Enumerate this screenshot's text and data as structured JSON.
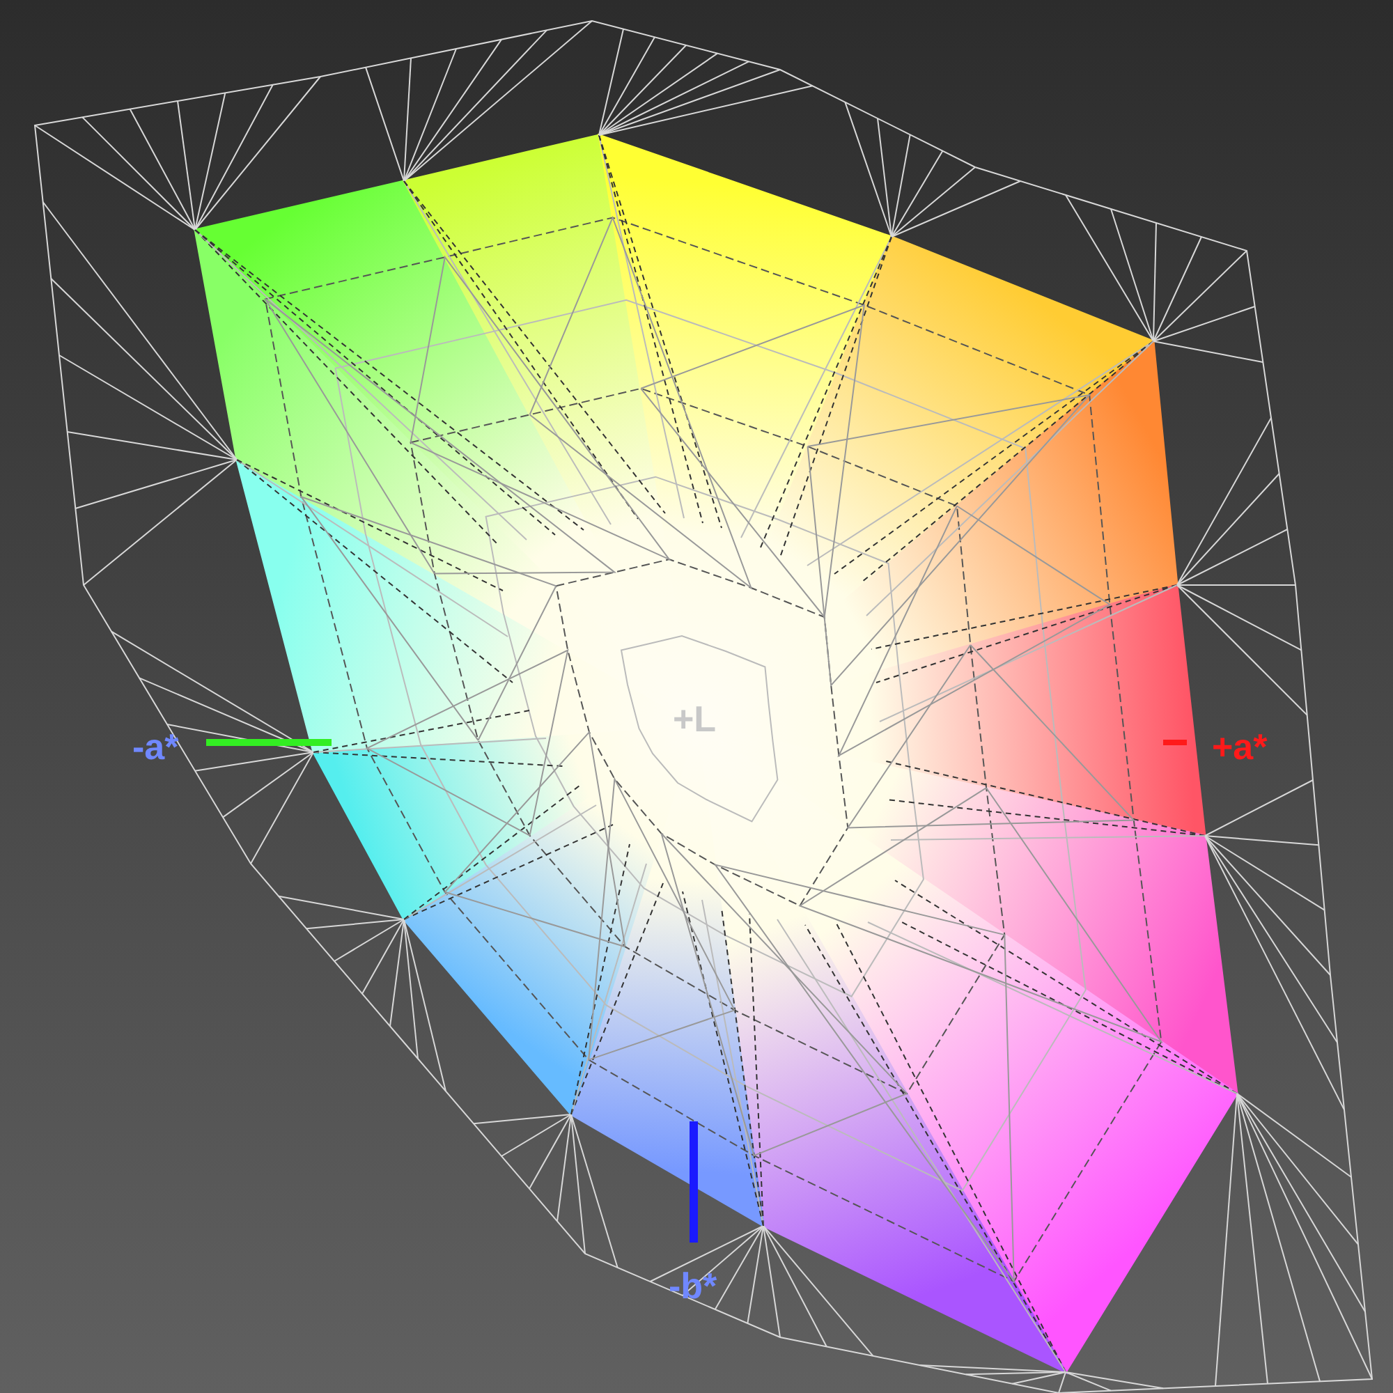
{
  "viewport": {
    "axis_labels": [
      {
        "text": "-a*",
        "kind": "neg_a",
        "color": "#7088ff"
      },
      {
        "text": "+a*",
        "kind": "pos_a",
        "color": "#ff1a1a"
      },
      {
        "text": "-b*",
        "kind": "neg_b",
        "color": "#7088ff"
      },
      {
        "text": "+L",
        "kind": "pos_l",
        "color": "#c8c8c8"
      }
    ]
  }
}
